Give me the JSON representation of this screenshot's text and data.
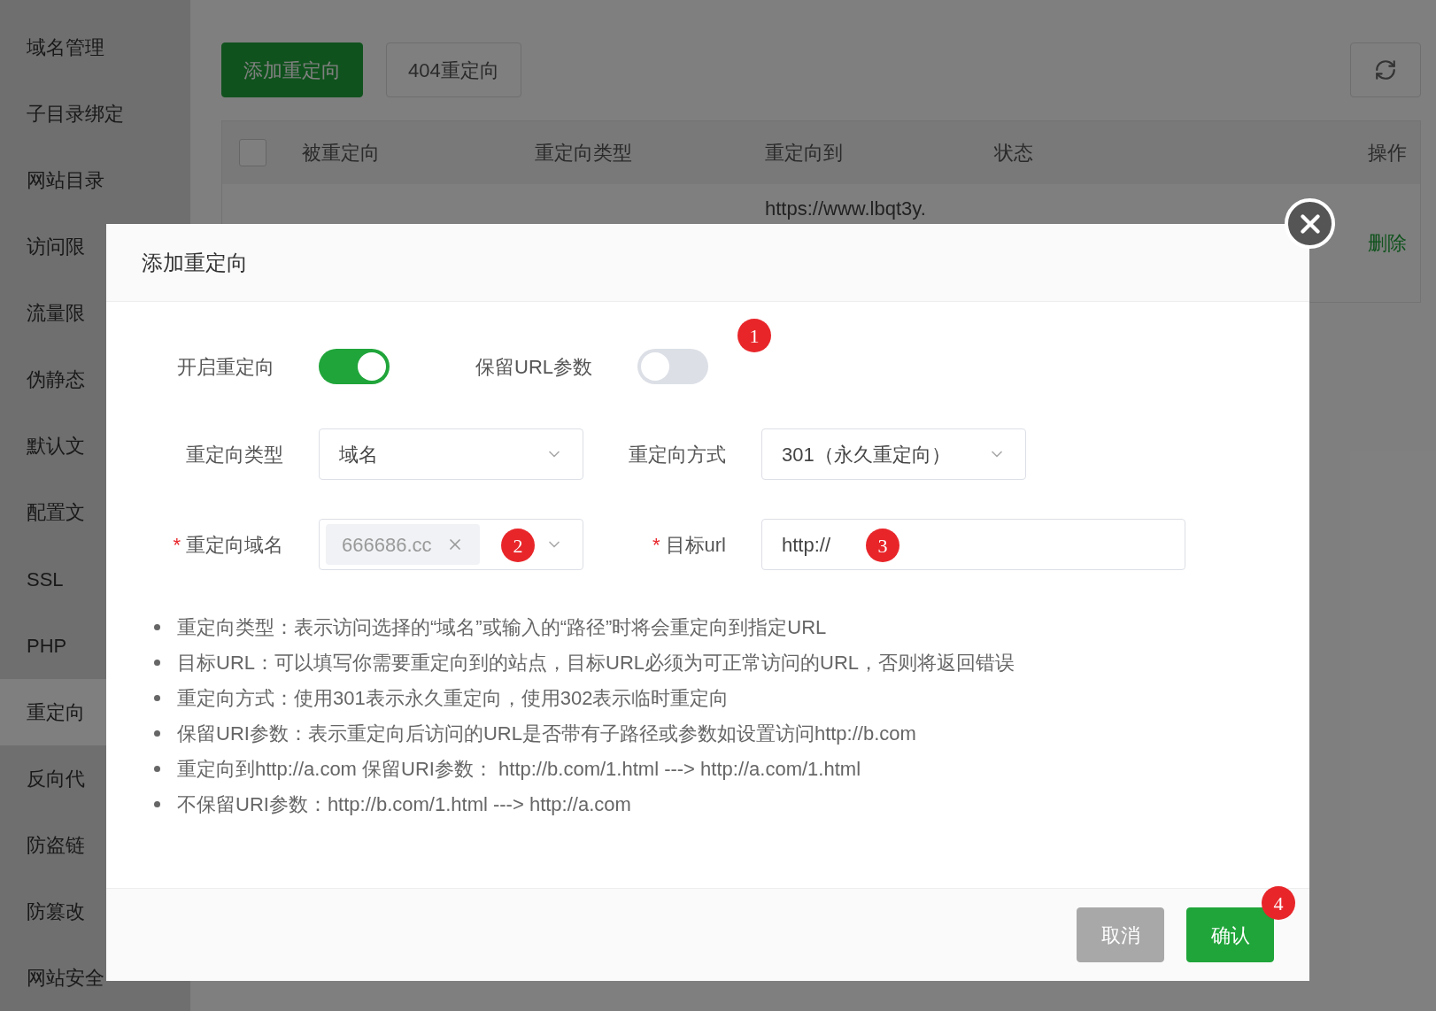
{
  "sidebar": {
    "items": [
      {
        "label": "域名管理",
        "selected": false
      },
      {
        "label": "子目录绑定",
        "selected": false
      },
      {
        "label": "网站目录",
        "selected": false
      },
      {
        "label": "访问限",
        "selected": false
      },
      {
        "label": "流量限",
        "selected": false
      },
      {
        "label": "伪静态",
        "selected": false
      },
      {
        "label": "默认文",
        "selected": false
      },
      {
        "label": "配置文",
        "selected": false
      },
      {
        "label": "SSL",
        "selected": false
      },
      {
        "label": "PHP",
        "selected": false
      },
      {
        "label": "重定向",
        "selected": true
      },
      {
        "label": "反向代",
        "selected": false
      },
      {
        "label": "防盗链",
        "selected": false
      },
      {
        "label": "防篡改",
        "selected": false
      },
      {
        "label": "网站安全",
        "selected": false
      }
    ]
  },
  "toolbar": {
    "buttons": [
      {
        "label": "添加重定向",
        "kind": "primary"
      },
      {
        "label": "404重定向",
        "kind": "default"
      }
    ]
  },
  "table": {
    "select_all": {
      "checked": false
    },
    "columns": [
      "被重定向",
      "重定向类型",
      "重定向到",
      "状态",
      "操作"
    ],
    "rows": [
      {
        "target": "https://www.lbqt3y.",
        "actions": [
          "删除"
        ]
      }
    ]
  },
  "dialog": {
    "title": "添加重定向",
    "switches": [
      {
        "label": "开启重定向",
        "on": true
      },
      {
        "label": "保留URL参数",
        "on": false,
        "badge": "1"
      }
    ],
    "selects": [
      {
        "label": "重定向类型",
        "value": "域名"
      },
      {
        "label": "重定向方式",
        "value": "301（永久重定向）"
      }
    ],
    "domain": {
      "required_mark": "*",
      "label": "重定向域名",
      "tag": "666686.cc",
      "badge": "2"
    },
    "url": {
      "required_mark": "*",
      "label": "目标url",
      "value": "http://",
      "badge": "3"
    },
    "notes": [
      "重定向类型：表示访问选择的“域名”或输入的“路径”时将会重定向到指定URL",
      "目标URL：可以填写你需要重定向到的站点，目标URL必须为可正常访问的URL，否则将返回错误",
      "重定向方式：使用301表示永久重定向，使用302表示临时重定向",
      "保留URI参数：表示重定向后访问的URL是否带有子路径或参数如设置访问http://b.com",
      "重定向到http://a.com 保留URI参数： http://b.com/1.html ---> http://a.com/1.html",
      "不保留URI参数：http://b.com/1.html ---> http://a.com"
    ],
    "buttons": [
      {
        "label": "取消",
        "kind": "cancel"
      },
      {
        "label": "确认",
        "kind": "primary",
        "badge": "4"
      }
    ]
  }
}
